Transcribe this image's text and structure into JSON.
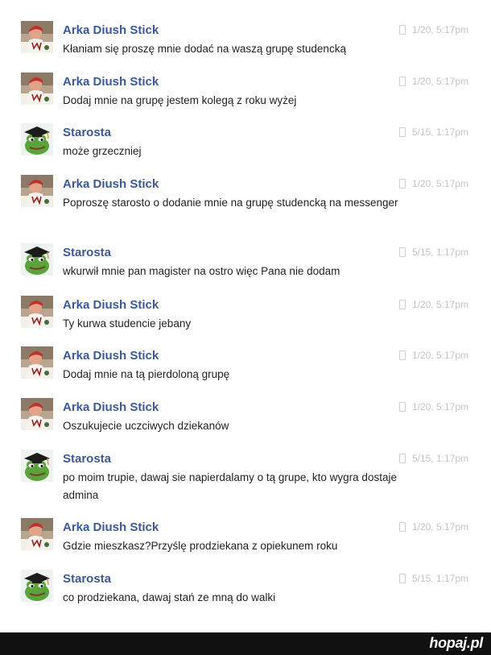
{
  "messages": [
    {
      "sender": "Arka Diush  Stick",
      "time": "1/20, 5:17pm",
      "text": "Kłaniam się proszę mnie dodać na waszą grupę  studencką",
      "avatar": "user-photo-avatar"
    },
    {
      "sender": "Arka Diush  Stick",
      "time": "1/20, 5:17pm",
      "text": "Dodaj mnie na grupę  jestem kolegą z roku wyżej",
      "avatar": "user-photo-avatar"
    },
    {
      "sender": "Starosta",
      "time": "5/15, 1:17pm",
      "text": "może grzeczniej",
      "avatar": "frog-graduate-avatar"
    },
    {
      "sender": "Arka Diush  Stick",
      "time": "1/20, 5:17pm",
      "text": "Poproszę starosto o dodanie mnie na grupę  studencką na messenger",
      "avatar": "user-photo-avatar"
    },
    {
      "sender": "Starosta",
      "time": "5/15, 1:17pm",
      "text": "wkurwił mnie pan  magister na ostro więc Pana nie dodam",
      "avatar": "frog-graduate-avatar"
    },
    {
      "sender": "Arka Diush  Stick",
      "time": "1/20, 5:17pm",
      "text": "Ty  kurwa  studencie jebany",
      "avatar": "user-photo-avatar"
    },
    {
      "sender": "Arka Diush  Stick",
      "time": "1/20, 5:17pm",
      "text": "Dodaj  mnie na tą pierdoloną  grupę",
      "avatar": "user-photo-avatar"
    },
    {
      "sender": "Arka Diush  Stick",
      "time": "1/20, 5:17pm",
      "text": "Oszukujecie uczciwych dziekanów",
      "avatar": "user-photo-avatar"
    },
    {
      "sender": "Starosta",
      "time": "5/15, 1:17pm",
      "text": "po moim trupie,  dawaj sie napierdalamy  o tą grupe,  kto wygra  dostaje admina",
      "avatar": "frog-graduate-avatar"
    },
    {
      "sender": "Arka Diush  Stick",
      "time": "1/20, 5:17pm",
      "text": "Gdzie mieszkasz?Przyślę prodziekana  z  opiekunem roku",
      "avatar": "user-photo-avatar"
    },
    {
      "sender": "Starosta",
      "time": "5/15, 1:17pm",
      "text": "co prodziekana,  dawaj  stań ze mną do walki",
      "avatar": "frog-graduate-avatar"
    }
  ],
  "footer": {
    "logo": "hopaj.pl"
  },
  "colors": {
    "sender_name": "#3b5998",
    "timestamp": "#c4c4c4",
    "footer_bg": "#111111"
  }
}
